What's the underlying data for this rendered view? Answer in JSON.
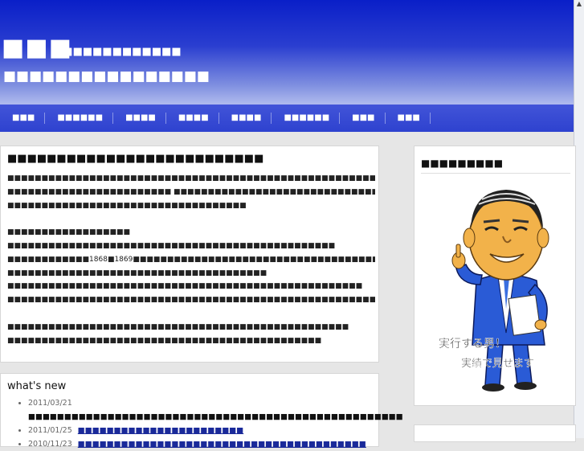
{
  "header": {
    "site_title": "■■■",
    "site_sub": "■■■■■■■■■■■■■",
    "tagline": "■■■■■■■■■■■■■■■■"
  },
  "nav": [
    "■■■",
    "■■■■■■",
    "■■■■",
    "■■■■",
    "■■■■",
    "■■■■■■",
    "■■■",
    "■■■"
  ],
  "main": {
    "heading": "■■■■■■■■■■■■■■■■■■■■■■■■■■",
    "lines": [
      "■■■■■■■■■■■■■■■■■■■■■■■■■■■■■■■■■■■■■■■■■■■■■■■■■■■■■■",
      "■■■■■■■■■■■■■■■■■■■■■■■■ ■■■■■■■■■■■■■■■■■■■■■■■■■■■■■■■■■■■■■■■■■■■■■■■■■■■■",
      "■■■■■■■■■■■■■■■■■■■■■■■■■■■■■■■■■■■",
      "",
      "■■■■■■■■■■■■■■■■■■",
      "■■■■■■■■■■■■■■■■■■■■■■■■■■■■■■■■■■■■■■■■■■■■■■■■",
      "■■■■■■■■■■■■1868■1869■■■■■■■■■■■■■■■■■■■■■■■■■■■■■■■■■■■■■■■■■■■■■■■■■■■■■■■■■■■■■",
      "■■■■■■■■■■■■■■■■■■■■■■■■■■■■■■■■■■■■■■",
      "■■■■■■■■■■■■■■■■■■■■■■■■■■■■■■■■■■■■■■■■■■■■■■■■■■■■",
      "■■■■■■■■■■■■■■■■■■■■■■■■■■■■■■■■■■■■■■■■■■■■■■■■■■■■■■■■■■■■■■■■■■■■■■■■■■■■■■■■■■■■",
      "",
      "■■■■■■■■■■■■■■■■■■■■■■■■■■■■■■■■■■■■■■■■■■■■■■■■■■",
      "■■■■■■■■■■■■■■■■■■■■■■■■■■■■■■■■■■■■■■■■■■■■■■"
    ]
  },
  "news": {
    "heading": "what's new",
    "items": [
      {
        "date": "2011/03/21",
        "title": "■■■■■■■■■■■■■■■■■■■■■■■■■■■■■■■■■■■■■■■■■■■■■■■■■■■■",
        "link": false
      },
      {
        "date": "2011/01/25",
        "title": "■■■■■■■■■■■■■■■■■■■■■■■",
        "link": true
      },
      {
        "date": "2010/11/23",
        "title": "■■■■■■■■■■■■■■■■■■■■■■■■■■■■■■■■■■■■■■■■",
        "link": true
      }
    ]
  },
  "sidebar": {
    "heading": "■■■■■■■■■",
    "caricature_line1": "実行する男！",
    "caricature_line2": "実績で見せます"
  },
  "colors": {
    "header_top": "#0a1fc8",
    "nav": "#3447d2",
    "suit": "#2a5bd6",
    "skin": "#f2b24a"
  }
}
